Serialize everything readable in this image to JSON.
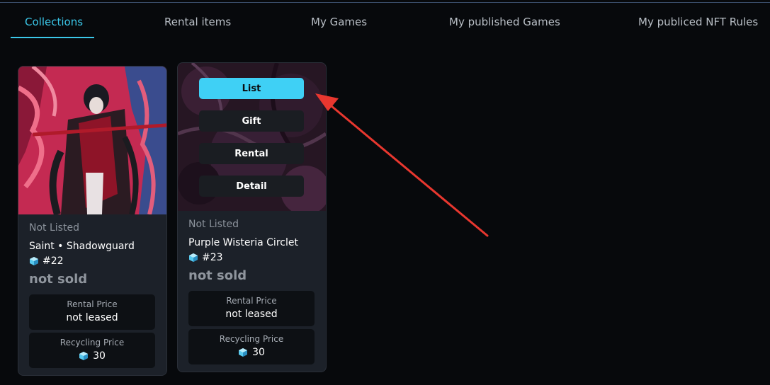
{
  "tabs": [
    {
      "label": "Collections",
      "active": true
    },
    {
      "label": "Rental items",
      "active": false
    },
    {
      "label": "My Games",
      "active": false
    },
    {
      "label": "My published Games",
      "active": false
    },
    {
      "label": "My publiced NFT Rules",
      "active": false
    }
  ],
  "cards": [
    {
      "status": "Not Listed",
      "name": "Saint • Shadowguard",
      "token": "#22",
      "sold": "not sold",
      "rental_label": "Rental Price",
      "rental_value": "not leased",
      "recycling_label": "Recycling Price",
      "recycling_value": "30"
    },
    {
      "status": "Not Listed",
      "name": "Purple Wisteria Circlet",
      "token": "#23",
      "sold": "not sold",
      "rental_label": "Rental Price",
      "rental_value": "not leased",
      "recycling_label": "Recycling Price",
      "recycling_value": "30",
      "menu": [
        "List",
        "Gift",
        "Rental",
        "Detail"
      ]
    }
  ],
  "colors": {
    "accent": "#3bc8ea",
    "button_primary": "#3fd0f5",
    "card_bg": "#1c2129",
    "annotation_arrow": "#e8372f"
  },
  "icons": {
    "token": "cube-icon"
  }
}
